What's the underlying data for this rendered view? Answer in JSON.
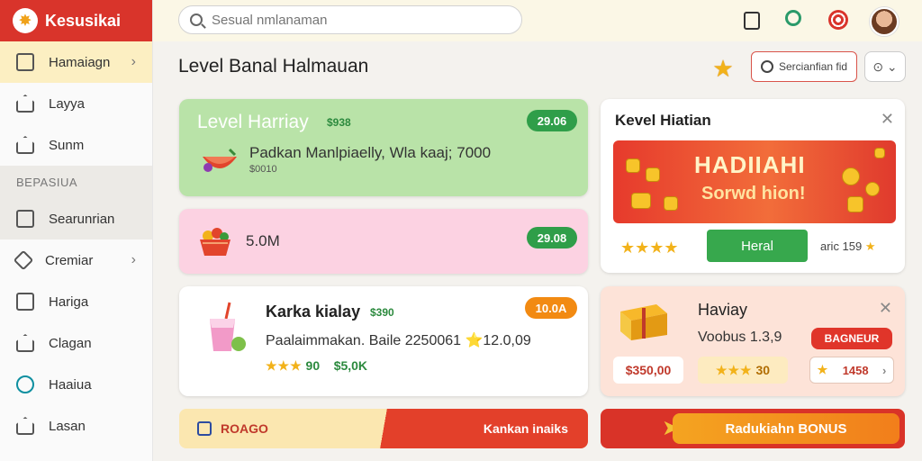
{
  "app": {
    "name": "Kesusikai"
  },
  "search": {
    "placeholder": "Sesual nmlanaman"
  },
  "sidebar": {
    "items": [
      {
        "label": "Hamaiagn",
        "active": true
      },
      {
        "label": "Layya"
      },
      {
        "label": "Sunm"
      }
    ],
    "section_label": "BEPASIUA",
    "section_items": [
      {
        "label": "Searunrian"
      },
      {
        "label": "Cremiar"
      },
      {
        "label": "Hariga"
      },
      {
        "label": "Clagan"
      },
      {
        "label": "Haaiua"
      },
      {
        "label": "Lasan"
      }
    ]
  },
  "main": {
    "title": "Level Banal Halmauan",
    "action_pill": "Sercianfian fid",
    "round_btn": "⊙ ⌄"
  },
  "cards": {
    "c1": {
      "title": "Level Harriay",
      "tag": "$938",
      "badge": "29.06",
      "line": "Padkan Manlpiaelly, Wla kaaj; 7000",
      "sub": "$0010"
    },
    "c2": {
      "value": "5.0M",
      "badge": "29.08"
    },
    "c3": {
      "title": "Karka kialay",
      "tag": "$390",
      "badge": "10.0A",
      "line": "Paalaimmakan. Baile 2250061 ⭐12.0,09",
      "rating": "90",
      "amount": "$5,0K"
    },
    "c4": {
      "title": "Kevel Hiatian",
      "banner_title": "HADIIAHI",
      "banner_sub": "Sorwd hion!",
      "button": "Heral",
      "side_text": "aric 159"
    },
    "c5": {
      "title": "Haviay",
      "line": "Voobus 1.3,9",
      "badge": "BAGNEUR",
      "price": "$350,00",
      "rating": "30",
      "count": "1458"
    }
  },
  "bars": {
    "left_label": "ROAGO",
    "right_label": "Kankan inaiks",
    "bonus": "Radukiahn BONUS"
  },
  "colors": {
    "brand": "#d9342b",
    "accent_green": "#2f9e49",
    "accent_orange": "#f28a12"
  }
}
